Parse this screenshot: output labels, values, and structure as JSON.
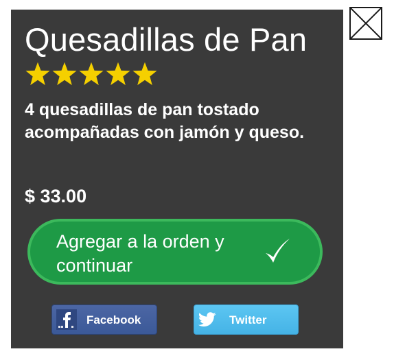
{
  "product": {
    "title": "Quesadillas de Pan",
    "rating": 5,
    "rating_max": 5,
    "description": "4 quesadillas de pan tostado acompañadas con jamón y queso.",
    "price": "$ 33.00"
  },
  "actions": {
    "order_label": "Agregar a la orden y continuar",
    "order_icon": "check-icon"
  },
  "share": {
    "facebook_label": "Facebook",
    "twitter_label": "Twitter"
  },
  "colors": {
    "card_background": "#3a3a3a",
    "star": "#f5d000",
    "order_button": "#1e9a46",
    "facebook": "#3b5998",
    "twitter": "#45b3e6"
  },
  "icons": {
    "close": "close-icon",
    "star": "star-icon",
    "facebook": "facebook-icon",
    "twitter": "twitter-icon"
  }
}
